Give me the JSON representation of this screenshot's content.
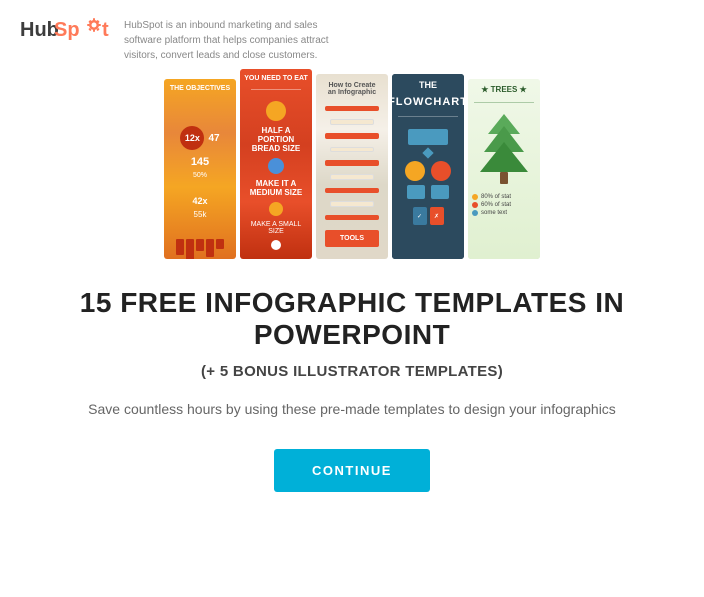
{
  "header": {
    "logo_hub": "Hub",
    "logo_spot": "Spot",
    "description": "HubSpot is an inbound marketing and sales software platform that helps companies attract visitors, convert leads and close customers."
  },
  "infographics": {
    "cards": [
      {
        "id": "card-1",
        "theme": "orange"
      },
      {
        "id": "card-2",
        "theme": "red"
      },
      {
        "id": "card-3",
        "theme": "light"
      },
      {
        "id": "card-4",
        "theme": "dark"
      },
      {
        "id": "card-5",
        "theme": "green"
      }
    ]
  },
  "main": {
    "title": "15 FREE INFOGRAPHIC TEMPLATES IN POWERPOINT",
    "subtitle": "(+ 5 BONUS ILLUSTRATOR TEMPLATES)",
    "description": "Save countless hours by using these pre-made\ntemplates to design your infographics",
    "button_label": "CONTINUE"
  }
}
